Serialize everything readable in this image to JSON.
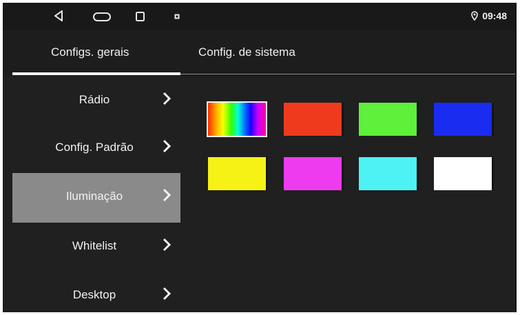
{
  "statusbar": {
    "time": "09:48",
    "icons": [
      "back-icon",
      "home-icon",
      "recent-apps-icon",
      "notification-icon",
      "location-icon"
    ]
  },
  "tabs": {
    "general": "Configs. gerais",
    "system": "Config. de sistema"
  },
  "sidebar": {
    "items": [
      {
        "label": "Rádio",
        "active": false
      },
      {
        "label": "Config. Padrão",
        "active": false
      },
      {
        "label": "Iluminação",
        "active": true
      },
      {
        "label": "Whitelist",
        "active": false
      },
      {
        "label": "Desktop",
        "active": false
      }
    ]
  },
  "colors": {
    "selected_index": 0,
    "swatches": [
      {
        "name": "rainbow"
      },
      {
        "name": "red",
        "hex": "#f03a1e"
      },
      {
        "name": "green",
        "hex": "#5ef03a"
      },
      {
        "name": "blue",
        "hex": "#1a2cf0"
      },
      {
        "name": "yellow",
        "hex": "#f7f215"
      },
      {
        "name": "magenta",
        "hex": "#ef3bef"
      },
      {
        "name": "cyan",
        "hex": "#4ef2f4"
      },
      {
        "name": "white",
        "hex": "#ffffff"
      }
    ]
  }
}
